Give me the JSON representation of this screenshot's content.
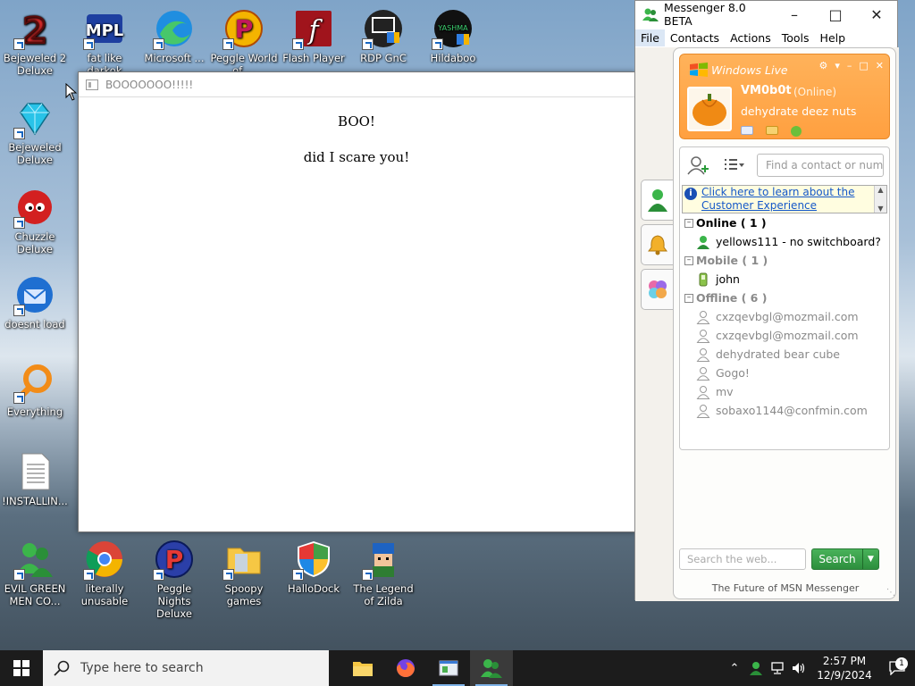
{
  "desktop": {
    "icons": [
      {
        "label": "Bejeweled 2 Deluxe"
      },
      {
        "label": "fat like darkok"
      },
      {
        "label": "Microsoft ..."
      },
      {
        "label": "Peggle World of ..."
      },
      {
        "label": "Flash Player"
      },
      {
        "label": "RDP GnC"
      },
      {
        "label": "Hildaboo"
      },
      {
        "label": "Bejeweled Deluxe"
      },
      {
        "label": "Chuzzle Deluxe"
      },
      {
        "label": "doesnt load"
      },
      {
        "label": "Everything"
      },
      {
        "label": "!INSTALLIN..."
      },
      {
        "label": "EVIL GREEN MEN CO..."
      },
      {
        "label": "literally unusable"
      },
      {
        "label": "Peggle Nights Deluxe"
      },
      {
        "label": "Spoopy games"
      },
      {
        "label": "HalloDock"
      },
      {
        "label": "The Legend of Zilda"
      }
    ]
  },
  "boo_window": {
    "title": "BOOOOOOO!!!!!",
    "line1": "BOO!",
    "line2": "did I scare you!"
  },
  "messenger": {
    "title": "Messenger 8.0 BETA",
    "menu": [
      "File",
      "Contacts",
      "Actions",
      "Tools",
      "Help"
    ],
    "brand": "Windows Live",
    "display_name": "VM0b0t",
    "status": "(Online)",
    "personal_message": "dehydrate deez nuts",
    "search_placeholder": "Find a contact or numbe",
    "notice_text": "Click here to learn about the Customer Experience",
    "groups": {
      "online": {
        "label": "Online ( 1 )",
        "contacts": [
          "yellows111 - no switchboard?"
        ]
      },
      "mobile": {
        "label": "Mobile ( 1 )",
        "contacts": [
          "john"
        ]
      },
      "offline": {
        "label": "Offline ( 6 )",
        "contacts": [
          "cxzqevbgl@mozmail.com",
          "cxzqevbgl@mozmail.com",
          "dehydrated bear cube",
          "Gogo!",
          "mv",
          "sobaxo1144@confmin.com"
        ]
      }
    },
    "web_search_placeholder": "Search the web...",
    "search_button": "Search",
    "tagline": "The Future of MSN Messenger"
  },
  "taskbar": {
    "search_placeholder": "Type here to search",
    "time": "2:57 PM",
    "date": "12/9/2024",
    "notification_count": "1"
  }
}
